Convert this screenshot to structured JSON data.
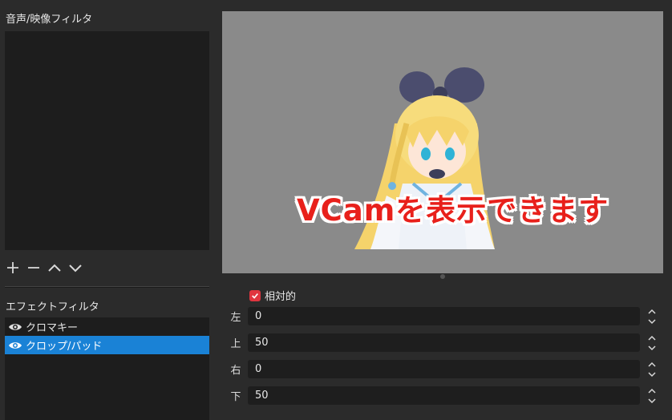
{
  "audio_filters": {
    "label": "音声/映像フィルタ"
  },
  "toolbar": {
    "add_icon": "plus-icon",
    "remove_icon": "minus-icon",
    "up_icon": "chevron-up-icon",
    "down_icon": "chevron-down-icon"
  },
  "effect_filters": {
    "label": "エフェクトフィルタ",
    "items": [
      {
        "name": "クロマキー",
        "selected": false,
        "visible": true
      },
      {
        "name": "クロップ/パッド",
        "selected": true,
        "visible": true
      }
    ]
  },
  "preview": {
    "caption": "VCamを表示できます",
    "background": "#8a8a8a",
    "caption_color": "#e8201b"
  },
  "relative": {
    "label": "相対的",
    "checked": true
  },
  "crop": {
    "rows": [
      {
        "label": "左",
        "value": "0"
      },
      {
        "label": "上",
        "value": "50"
      },
      {
        "label": "右",
        "value": "0"
      },
      {
        "label": "下",
        "value": "50"
      }
    ]
  },
  "colors": {
    "accent": "#1a82d6",
    "checkbox": "#e0353f",
    "panel": "#1d1d1d",
    "window": "#2b2b2b"
  }
}
